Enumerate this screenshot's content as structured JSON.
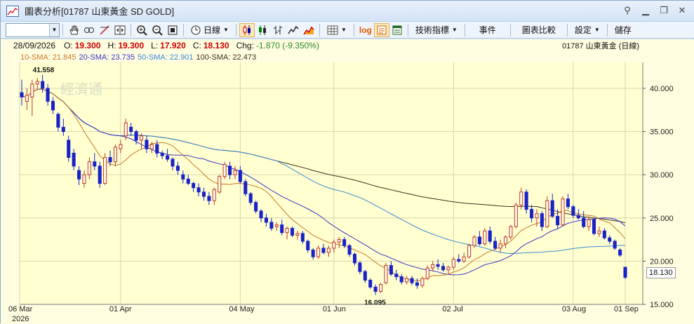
{
  "window": {
    "title": "圖表分析[01787 山東黃金 SD GOLD]",
    "controls": [
      "attach-icon",
      "minimize-icon",
      "restore-icon",
      "close-icon"
    ]
  },
  "toolbar": {
    "combo_value": "",
    "period_label": "日線",
    "indicators_label": "技術指標",
    "events_label": "事件",
    "compare_label": "圖表比較",
    "settings_label": "設定",
    "save_label": "儲存",
    "log_label": "log"
  },
  "info": {
    "date": "28/09/2026",
    "open_label": "O:",
    "open": "19.300",
    "high_label": "H:",
    "high": "19.300",
    "low_label": "L:",
    "low": "17.920",
    "close_label": "C:",
    "close": "18.130",
    "chg_label": "Chg:",
    "chg": "-1.870 (-9.350%)",
    "symbol": "01787  山東黃金 (日線)"
  },
  "sma": {
    "sma10": "10-SMA: 21.845",
    "sma20": "20-SMA: 23.735",
    "sma50": "50-SMA: 22.901",
    "sma100": "100-SMA: 22.473"
  },
  "colors": {
    "up": "#c0392b",
    "down": "#1a23c8",
    "sma10": "#c8782a",
    "sma20": "#3a33c7",
    "sma50": "#3a88d8",
    "sma100": "#3b3118"
  },
  "watermark": "經濟通",
  "chart_data": {
    "type": "candlestick",
    "ylim": [
      15,
      43
    ],
    "y_ticks": [
      "15.000",
      "20.000",
      "25.000",
      "30.000",
      "35.000",
      "40.000"
    ],
    "x_ticks": [
      "06 Mar",
      "01 Apr",
      "04 May",
      "01 Jun",
      "02 Jul",
      "03 Aug",
      "01 Sep"
    ],
    "x_year": "2026",
    "annotations": {
      "high": "41.558",
      "low": "16.095"
    },
    "last_price": "18.130",
    "candles_ohlc": [
      [
        39.5,
        41.0,
        38.0,
        39.0
      ],
      [
        38.5,
        40.0,
        37.5,
        39.2
      ],
      [
        39.0,
        41.0,
        36.8,
        40.5
      ],
      [
        40.5,
        41.2,
        39.8,
        40.8
      ],
      [
        40.8,
        41.558,
        39.5,
        40.0
      ],
      [
        40.0,
        40.5,
        38.0,
        38.5
      ],
      [
        38.5,
        39.0,
        37.0,
        37.5
      ],
      [
        37.0,
        37.2,
        35.0,
        35.5
      ],
      [
        35.5,
        36.5,
        34.5,
        35.0
      ],
      [
        34.0,
        34.5,
        31.5,
        32.0
      ],
      [
        32.5,
        33.0,
        30.5,
        31.0
      ],
      [
        30.5,
        31.0,
        28.8,
        29.5
      ],
      [
        29.0,
        30.5,
        28.5,
        30.0
      ],
      [
        30.0,
        32.0,
        29.5,
        31.5
      ],
      [
        31.5,
        32.5,
        30.5,
        31.0
      ],
      [
        31.0,
        31.5,
        28.5,
        29.0
      ],
      [
        29.0,
        32.5,
        28.8,
        32.0
      ],
      [
        32.0,
        32.8,
        31.0,
        31.5
      ],
      [
        31.5,
        33.5,
        31.0,
        33.2
      ],
      [
        33.0,
        34.0,
        32.5,
        33.5
      ],
      [
        34.5,
        36.5,
        34.0,
        36.0
      ],
      [
        35.5,
        36.0,
        34.5,
        35.0
      ],
      [
        35.0,
        35.2,
        33.5,
        34.0
      ],
      [
        34.0,
        34.8,
        33.0,
        34.5
      ],
      [
        34.0,
        34.5,
        32.5,
        33.0
      ],
      [
        33.0,
        33.8,
        32.5,
        33.5
      ],
      [
        33.5,
        34.0,
        32.0,
        32.5
      ],
      [
        32.5,
        32.8,
        31.8,
        32.2
      ],
      [
        32.2,
        33.0,
        31.5,
        31.8
      ],
      [
        31.8,
        32.0,
        30.5,
        31.0
      ],
      [
        31.0,
        31.5,
        30.0,
        30.5
      ],
      [
        30.0,
        30.5,
        29.0,
        29.5
      ],
      [
        29.5,
        30.0,
        28.8,
        29.0
      ],
      [
        29.0,
        29.2,
        28.0,
        28.5
      ],
      [
        28.5,
        29.0,
        27.5,
        28.0
      ],
      [
        28.0,
        28.5,
        27.0,
        27.5
      ],
      [
        27.5,
        28.0,
        26.5,
        27.0
      ],
      [
        27.0,
        28.5,
        26.5,
        28.3
      ],
      [
        28.0,
        30.0,
        27.8,
        29.8
      ],
      [
        29.8,
        31.5,
        29.5,
        31.2
      ],
      [
        31.0,
        31.5,
        29.5,
        30.0
      ],
      [
        30.0,
        31.0,
        29.5,
        30.5
      ],
      [
        30.5,
        31.0,
        29.0,
        29.2
      ],
      [
        29.2,
        29.5,
        27.5,
        27.8
      ],
      [
        27.8,
        28.0,
        26.5,
        26.8
      ],
      [
        26.8,
        27.0,
        25.5,
        25.8
      ],
      [
        25.8,
        26.0,
        24.5,
        25.0
      ],
      [
        25.0,
        25.5,
        24.0,
        24.5
      ],
      [
        24.5,
        25.0,
        23.5,
        23.8
      ],
      [
        24.0,
        24.5,
        23.5,
        24.2
      ],
      [
        24.2,
        24.8,
        23.0,
        23.3
      ],
      [
        23.3,
        24.0,
        22.5,
        23.8
      ],
      [
        23.8,
        24.0,
        22.8,
        23.0
      ],
      [
        23.0,
        23.5,
        22.5,
        23.2
      ],
      [
        23.2,
        23.5,
        22.0,
        22.3
      ],
      [
        22.3,
        22.5,
        21.0,
        21.3
      ],
      [
        21.3,
        21.5,
        20.2,
        20.5
      ],
      [
        20.5,
        21.8,
        20.3,
        21.5
      ],
      [
        21.5,
        22.0,
        20.8,
        21.0
      ],
      [
        21.0,
        21.8,
        20.5,
        21.5
      ],
      [
        21.5,
        22.5,
        21.0,
        22.2
      ],
      [
        22.2,
        22.8,
        21.5,
        22.5
      ],
      [
        22.5,
        22.8,
        21.5,
        21.8
      ],
      [
        21.8,
        22.0,
        20.5,
        20.8
      ],
      [
        20.8,
        21.0,
        19.5,
        19.8
      ],
      [
        19.8,
        20.0,
        18.5,
        18.8
      ],
      [
        18.8,
        19.0,
        17.5,
        17.8
      ],
      [
        17.8,
        18.0,
        16.8,
        17.0
      ],
      [
        17.0,
        17.3,
        16.095,
        16.5
      ],
      [
        16.5,
        17.5,
        16.3,
        17.3
      ],
      [
        17.5,
        19.8,
        17.3,
        19.5
      ],
      [
        19.5,
        20.0,
        18.3,
        18.5
      ],
      [
        18.5,
        19.0,
        17.8,
        18.2
      ],
      [
        18.2,
        18.5,
        17.3,
        17.6
      ],
      [
        17.6,
        18.3,
        17.3,
        18.0
      ],
      [
        18.0,
        18.3,
        17.2,
        17.5
      ],
      [
        17.5,
        18.0,
        16.8,
        17.2
      ],
      [
        17.2,
        18.2,
        16.9,
        18.0
      ],
      [
        18.0,
        19.5,
        17.8,
        19.2
      ],
      [
        19.2,
        20.0,
        18.8,
        19.6
      ],
      [
        19.6,
        20.2,
        19.0,
        19.4
      ],
      [
        19.4,
        19.8,
        18.8,
        19.0
      ],
      [
        19.0,
        19.5,
        18.5,
        19.3
      ],
      [
        19.3,
        20.5,
        19.0,
        20.2
      ],
      [
        20.2,
        20.8,
        19.8,
        20.0
      ],
      [
        20.0,
        21.0,
        19.8,
        20.5
      ],
      [
        20.5,
        22.0,
        20.3,
        21.8
      ],
      [
        21.8,
        23.0,
        21.5,
        22.8
      ],
      [
        22.8,
        23.5,
        21.8,
        22.0
      ],
      [
        22.0,
        23.8,
        21.8,
        23.5
      ],
      [
        23.5,
        24.0,
        22.0,
        22.3
      ],
      [
        22.3,
        22.8,
        21.3,
        21.5
      ],
      [
        21.5,
        22.5,
        21.0,
        22.0
      ],
      [
        22.0,
        23.0,
        21.5,
        22.8
      ],
      [
        22.8,
        24.2,
        22.5,
        24.0
      ],
      [
        24.0,
        26.8,
        23.8,
        26.5
      ],
      [
        26.5,
        28.5,
        26.0,
        28.0
      ],
      [
        28.0,
        28.3,
        25.5,
        26.0
      ],
      [
        26.0,
        26.5,
        24.5,
        25.0
      ],
      [
        25.0,
        26.0,
        24.0,
        25.5
      ],
      [
        25.5,
        25.8,
        23.5,
        24.0
      ],
      [
        24.0,
        27.5,
        23.8,
        27.0
      ],
      [
        27.0,
        27.8,
        25.0,
        25.2
      ],
      [
        25.2,
        26.0,
        23.8,
        24.2
      ],
      [
        24.2,
        27.5,
        24.0,
        27.2
      ],
      [
        27.2,
        27.8,
        26.0,
        26.3
      ],
      [
        26.3,
        26.5,
        25.0,
        25.3
      ],
      [
        25.3,
        26.0,
        24.8,
        25.0
      ],
      [
        25.0,
        25.8,
        23.8,
        24.0
      ],
      [
        24.0,
        25.0,
        23.5,
        24.8
      ],
      [
        24.8,
        25.0,
        23.0,
        23.2
      ],
      [
        23.2,
        24.0,
        22.8,
        23.5
      ],
      [
        23.5,
        23.8,
        22.5,
        22.7
      ],
      [
        22.7,
        23.0,
        22.0,
        22.3
      ],
      [
        22.3,
        22.5,
        21.3,
        21.5
      ],
      [
        21.3,
        21.5,
        20.5,
        20.7
      ],
      [
        19.3,
        19.3,
        17.92,
        18.13
      ]
    ]
  }
}
